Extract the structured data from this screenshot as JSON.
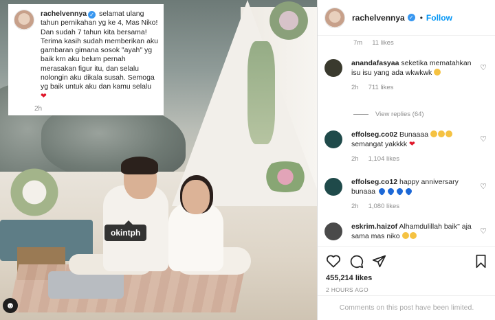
{
  "caption": {
    "username": "rachelvennya",
    "text": "selamat ulang tahun pernikahan yg ke 4, Mas Niko! Dan sudah 7 tahun kita bersama! Terima kasih sudah memberikan aku gambaran gimana sosok \"ayah\" yg baik krn aku belum pernah merasakan figur itu, dan selalu nolongin aku dikala susah. Semoga yg baik untuk aku dan kamu selalu",
    "time": "2h"
  },
  "photo": {
    "tag_label": "okintph"
  },
  "header": {
    "username": "rachelvennya",
    "dot": "•",
    "follow_label": "Follow"
  },
  "top_meta": {
    "time": "7m",
    "likes": "11 likes"
  },
  "comments": [
    {
      "username": "anandafasyaa",
      "text": "seketika mematahkan isu isu yang ada wkwkwk",
      "time": "2h",
      "likes": "711 likes",
      "avatar_color": "#3a3a2e"
    },
    {
      "username": "effolseg.co02",
      "text": "Bunaaaa",
      "text2": "semangat yakkkk",
      "time": "2h",
      "likes": "1,104 likes",
      "avatar_color": "#1f4a4a"
    },
    {
      "username": "effolseg.co12",
      "text": "happy anniversary bunaaa",
      "time": "2h",
      "likes": "1,080 likes",
      "avatar_color": "#1f4a4a"
    },
    {
      "username": "eskrim.haizof",
      "text": "Alhamdulillah baik\" aja sama mas niko",
      "avatar_color": "#4a4a4a"
    }
  ],
  "view_replies": "View replies (64)",
  "actions": {
    "like_count": "455,214 likes",
    "post_time": "2 HOURS AGO",
    "limited_text": "Comments on this post have been limited."
  },
  "icons": [
    "heart-icon",
    "comment-icon",
    "share-icon",
    "bookmark-icon",
    "verified-icon",
    "user-tag-icon"
  ]
}
